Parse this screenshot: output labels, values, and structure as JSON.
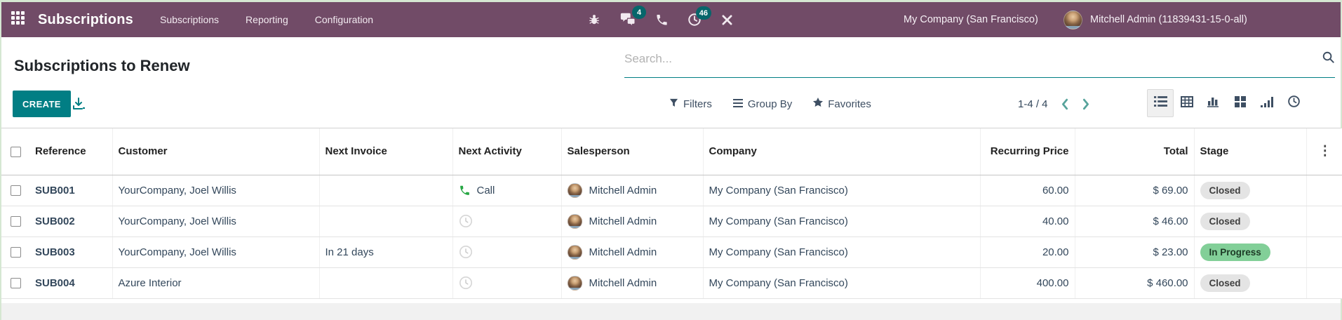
{
  "topbar": {
    "brand": "Subscriptions",
    "menus": [
      "Subscriptions",
      "Reporting",
      "Configuration"
    ],
    "systray_icons": [
      "bug",
      "messages",
      "phone",
      "activities",
      "tools"
    ],
    "messages_badge": "4",
    "activities_badge": "46",
    "company": "My Company (San Francisco)",
    "user": "Mitchell Admin (11839431-15-0-all)"
  },
  "control": {
    "title": "Subscriptions to Renew",
    "create_label": "CREATE",
    "search_placeholder": "Search...",
    "filters_label": "Filters",
    "group_by_label": "Group By",
    "favorites_label": "Favorites",
    "pagination": "1-4 / 4",
    "view_switcher": [
      "list",
      "pivot",
      "graph",
      "kanban",
      "cohort",
      "activity"
    ],
    "active_view": "list"
  },
  "table": {
    "headers": [
      "Reference",
      "Customer",
      "Next Invoice",
      "Next Activity",
      "Salesperson",
      "Company",
      "Recurring Price",
      "Total",
      "Stage"
    ],
    "rows": [
      {
        "reference": "SUB001",
        "customer": "YourCompany, Joel Willis",
        "next_invoice": "",
        "next_activity": "call",
        "next_activity_label": "Call",
        "salesperson": "Mitchell Admin",
        "company": "My Company (San Francisco)",
        "recurring_price": "60.00",
        "total": "$ 69.00",
        "stage": "Closed",
        "stage_variant": "closed"
      },
      {
        "reference": "SUB002",
        "customer": "YourCompany, Joel Willis",
        "next_invoice": "",
        "next_activity": "clock",
        "next_activity_label": "",
        "salesperson": "Mitchell Admin",
        "company": "My Company (San Francisco)",
        "recurring_price": "40.00",
        "total": "$ 46.00",
        "stage": "Closed",
        "stage_variant": "closed"
      },
      {
        "reference": "SUB003",
        "customer": "YourCompany, Joel Willis",
        "next_invoice": "In 21 days",
        "next_activity": "clock",
        "next_activity_label": "",
        "salesperson": "Mitchell Admin",
        "company": "My Company (San Francisco)",
        "recurring_price": "20.00",
        "total": "$ 23.00",
        "stage": "In Progress",
        "stage_variant": "in_progress"
      },
      {
        "reference": "SUB004",
        "customer": "Azure Interior",
        "next_invoice": "",
        "next_activity": "clock",
        "next_activity_label": "",
        "salesperson": "Mitchell Admin",
        "company": "My Company (San Francisco)",
        "recurring_price": "400.00",
        "total": "$ 460.00",
        "stage": "Closed",
        "stage_variant": "closed"
      }
    ]
  },
  "colors": {
    "topbar_bg": "#714B67",
    "accent_teal": "#017E84",
    "notification_badge": "#07666B",
    "chevron_teal": "#57A39B",
    "call_green": "#28A745",
    "stage_closed_bg": "#E4E4E4",
    "stage_in_progress_bg": "#82CF98",
    "body_text": "#33475B"
  }
}
